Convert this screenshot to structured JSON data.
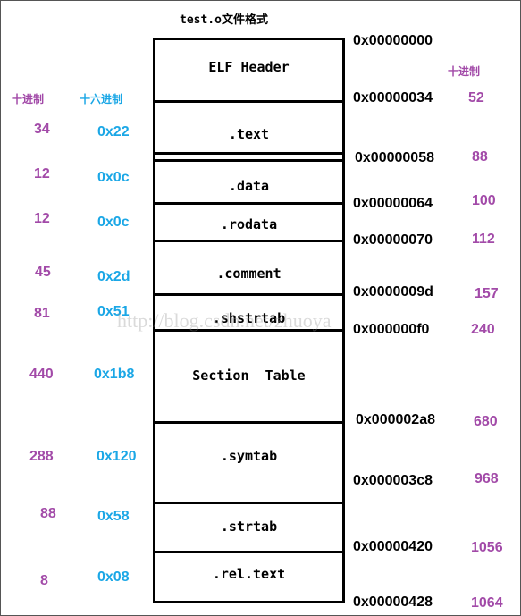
{
  "title": "test.o文件格式",
  "headers": {
    "left_decimal": "十进制",
    "left_hex": "十六进制",
    "right_decimal": "十进制"
  },
  "sections": [
    {
      "name": "ELF Header"
    },
    {
      "name": ".text",
      "size_dec": "34",
      "size_hex": "0x22"
    },
    {
      "name": ".data",
      "size_dec": "12",
      "size_hex": "0x0c"
    },
    {
      "name": ".rodata",
      "size_dec": "12",
      "size_hex": "0x0c"
    },
    {
      "name": ".comment",
      "size_dec": "45",
      "size_hex": "0x2d"
    },
    {
      "name": ".shstrtab",
      "size_dec": "81",
      "size_hex": "0x51"
    },
    {
      "name": "Section  Table",
      "size_dec": "440",
      "size_hex": "0x1b8"
    },
    {
      "name": ".symtab",
      "size_dec": "288",
      "size_hex": "0x120"
    },
    {
      "name": ".strtab",
      "size_dec": "88",
      "size_hex": "0x58"
    },
    {
      "name": ".rel.text",
      "size_dec": "8",
      "size_hex": "0x08"
    }
  ],
  "offsets": [
    {
      "hex": "0x00000000",
      "dec": ""
    },
    {
      "hex": "0x00000034",
      "dec": "52"
    },
    {
      "hex": "0x00000058",
      "dec": "88"
    },
    {
      "hex": "0x00000064",
      "dec": "100"
    },
    {
      "hex": "0x00000070",
      "dec": "112"
    },
    {
      "hex": "0x0000009d",
      "dec": "157"
    },
    {
      "hex": "0x000000f0",
      "dec": "240"
    },
    {
      "hex": "0x000002a8",
      "dec": "680"
    },
    {
      "hex": "0x000003c8",
      "dec": "968"
    },
    {
      "hex": "0x00000420",
      "dec": "1056"
    },
    {
      "hex": "0x00000428",
      "dec": "1064"
    }
  ],
  "watermark": "http://blog.csdn.net/zhuoya",
  "colors": {
    "decimal": "#a24aa8",
    "hex": "#1ba7e6"
  }
}
